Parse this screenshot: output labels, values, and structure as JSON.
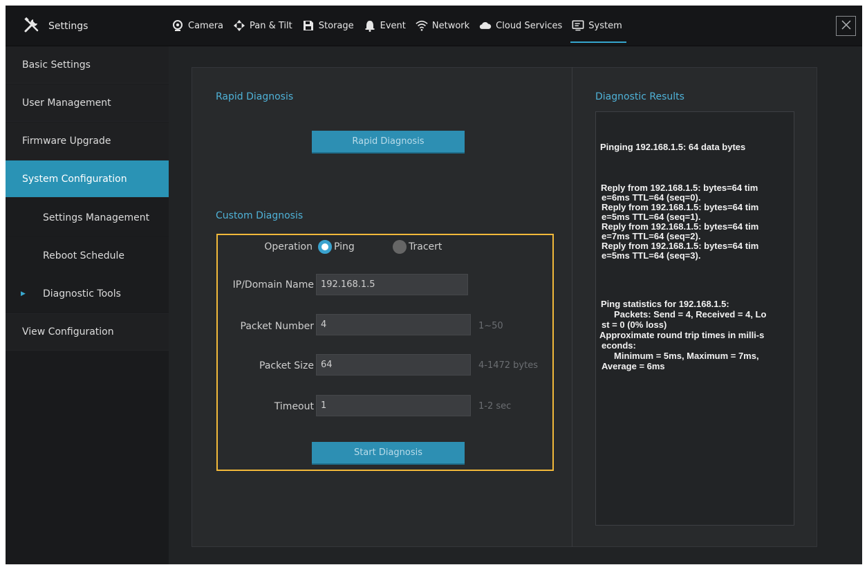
{
  "header": {
    "title": "Settings",
    "tabs": [
      {
        "label": "Camera",
        "icon": "camera-icon"
      },
      {
        "label": "Pan & Tilt",
        "icon": "pan-tilt-icon"
      },
      {
        "label": "Storage",
        "icon": "storage-icon"
      },
      {
        "label": "Event",
        "icon": "bell-icon"
      },
      {
        "label": "Network",
        "icon": "wifi-icon"
      },
      {
        "label": "Cloud Services",
        "icon": "cloud-icon"
      },
      {
        "label": "System",
        "icon": "monitor-icon",
        "active": true
      }
    ]
  },
  "sidebar": {
    "items": [
      {
        "label": "Basic Settings"
      },
      {
        "label": "User Management"
      },
      {
        "label": "Firmware Upgrade"
      },
      {
        "label": "System Configuration",
        "active": true
      },
      {
        "label": "Settings Management"
      },
      {
        "label": "Reboot Schedule"
      },
      {
        "label": "Diagnostic Tools"
      },
      {
        "label": "View Configuration"
      }
    ]
  },
  "rapid": {
    "title": "Rapid Diagnosis",
    "button": "Rapid Diagnosis"
  },
  "custom": {
    "title": "Custom Diagnosis",
    "operation_label": "Operation",
    "ping_label": "Ping",
    "tracert_label": "Tracert",
    "selected_operation": "Ping",
    "ip_label": "IP/Domain Name",
    "ip_value": "192.168.1.5",
    "packet_number_label": "Packet Number",
    "packet_number_value": "4",
    "packet_number_hint": "1~50",
    "packet_size_label": "Packet Size",
    "packet_size_value": "64",
    "packet_size_hint": "4-1472 bytes",
    "timeout_label": "Timeout",
    "timeout_value": "1",
    "timeout_hint": "1-2 sec",
    "start_button": "Start Diagnosis"
  },
  "results": {
    "title": "Diagnostic Results",
    "lines": [
      "Pinging 192.168.1.5: 64 data bytes",
      "Reply from 192.168.1.5: bytes=64 tim",
      "e=6ms TTL=64 (seq=0).",
      "Reply from 192.168.1.5: bytes=64 tim",
      "e=5ms TTL=64 (seq=1).",
      "Reply from 192.168.1.5: bytes=64 tim",
      "e=7ms TTL=64 (seq=2).",
      "Reply from 192.168.1.5: bytes=64 tim",
      "e=5ms TTL=64 (seq=3).",
      "Ping statistics for 192.168.1.5:",
      "     Packets: Send = 4, Received = 4, Lo",
      "st = 0 (0% loss)",
      "Approximate round trip times in milli-s",
      "econds:",
      "     Minimum = 5ms, Maximum = 7ms,",
      "Average = 6ms"
    ]
  },
  "colors": {
    "accent": "#2a93b5",
    "highlight_border": "#f2b93a",
    "background": "#212325"
  }
}
